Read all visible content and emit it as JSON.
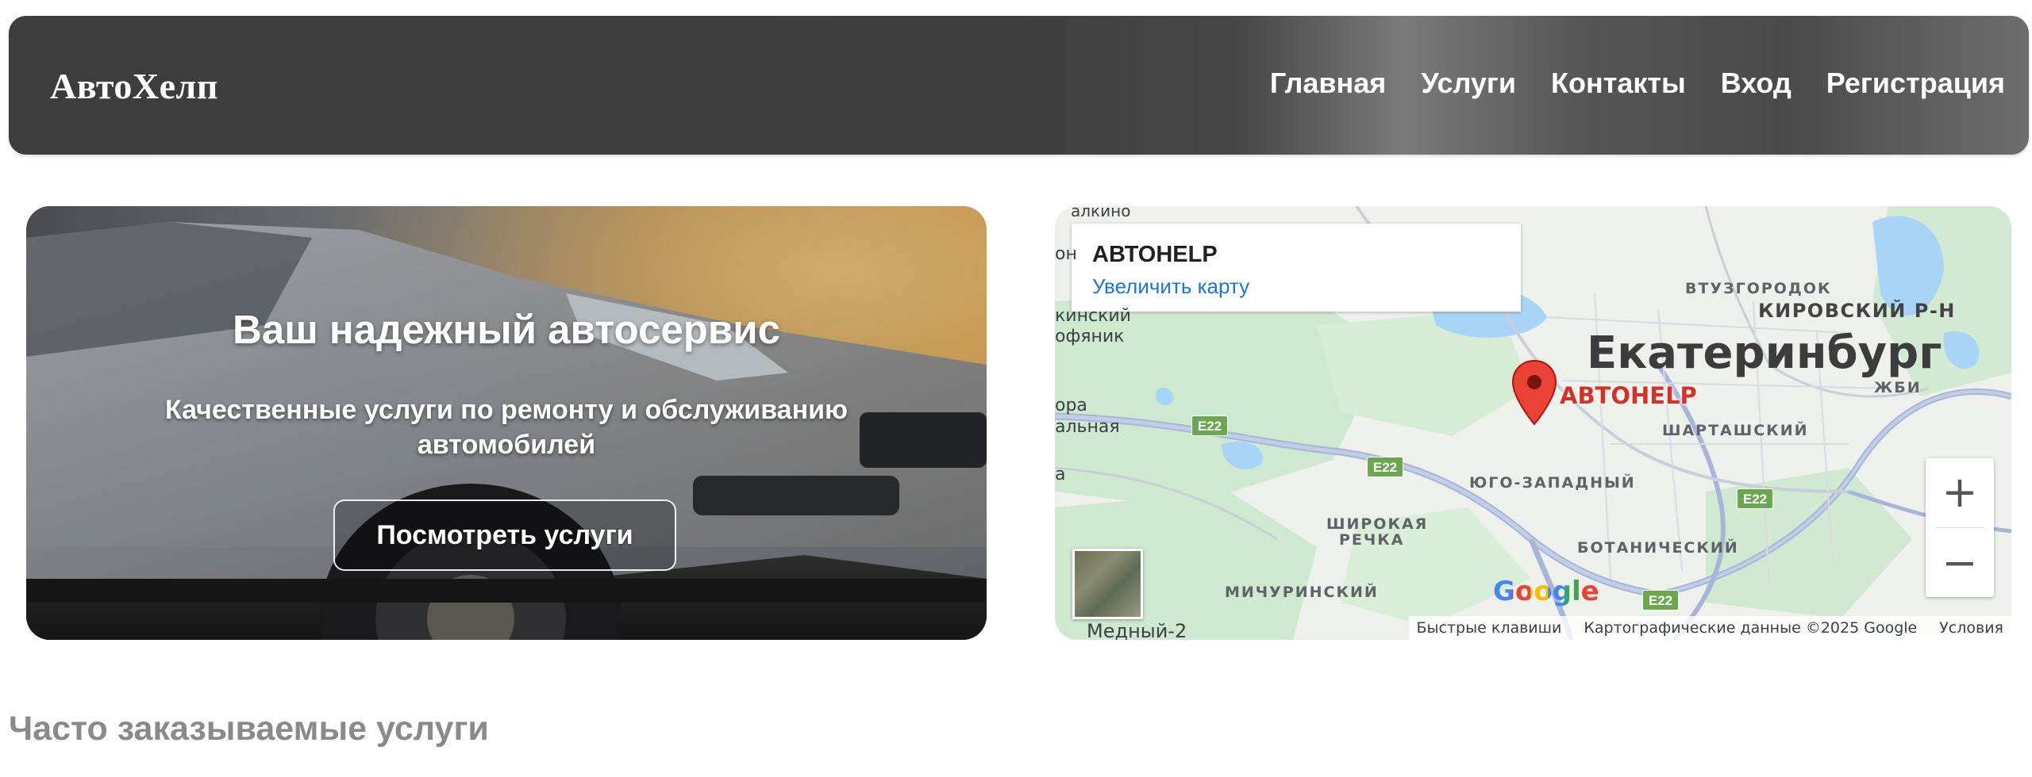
{
  "header": {
    "logo": "АвтоХелп",
    "nav": [
      "Главная",
      "Услуги",
      "Контакты",
      "Вход",
      "Регистрация"
    ]
  },
  "hero": {
    "title": "Ваш надежный автосервис",
    "subtitle": "Качественные услуги по ремонту и обслуживанию автомобилей",
    "button_label": "Посмотреть услуги"
  },
  "map": {
    "card_title": "АВТОHELP",
    "card_link": "Увеличить карту",
    "city": "Екатеринбург",
    "marker_label": "АВТОHELP",
    "districts": [
      "ВТУЗГОРОДОК",
      "КИРОВСКИЙ Р-Н",
      "ЖБИ",
      "ШАРТАШСКИЙ",
      "ЮГО-ЗАПАДНЫЙ",
      "ШИРОКАЯ",
      "РЕЧКА",
      "БОТАНИЧЕСКИЙ",
      "МИЧУРИНСКИЙ"
    ],
    "edge_labels": [
      "алкино",
      "он",
      "кинский",
      "офяник",
      "ора",
      "альная",
      "а",
      "Медный-2"
    ],
    "road_badge": "E22",
    "zoom_in": "+",
    "zoom_out": "−",
    "google": "Google",
    "attribution": [
      "Быстрые клавиши",
      "Картографические данные ©2025 Google",
      "Условия"
    ]
  },
  "section": {
    "title": "Часто заказываемые услуги"
  },
  "colors": {
    "header_dark": "#3d3d3d",
    "link_blue": "#1a73e8",
    "marker_red": "#ea4335",
    "road_green": "#6aa84f",
    "section_gray": "#8a8a8a"
  }
}
